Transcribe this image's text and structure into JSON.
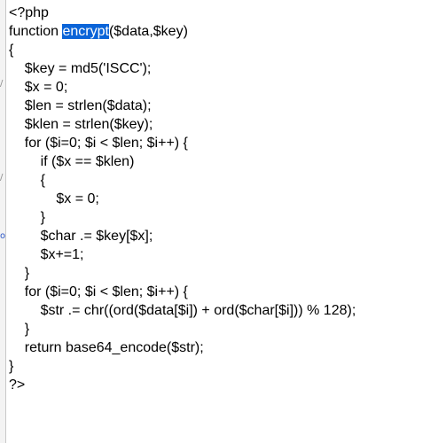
{
  "editor": {
    "lines": [
      "<?php",
      "function ",
      "{",
      "    $key = md5('ISCC');",
      "    $x = 0;",
      "    $len = strlen($data);",
      "    $klen = strlen($key);",
      "    for ($i=0; $i < $len; $i++) {",
      "        if ($x == $klen)",
      "        {",
      "            $x = 0;",
      "        }",
      "        $char .= $key[$x];",
      "        $x+=1;",
      "    }",
      "    for ($i=0; $i < $len; $i++) {",
      "        $str .= chr((ord($data[$i]) + ord($char[$i])) % 128);",
      "    }",
      "    return base64_encode($str);",
      "}",
      "?>"
    ],
    "selected_word": "encrypt",
    "after_selection": "($data,$key)"
  },
  "gutter_marks": [
    "/",
    "/",
    "o"
  ],
  "colors": {
    "selection": "#0a64d8",
    "text": "#000000",
    "background": "#ffffff"
  }
}
